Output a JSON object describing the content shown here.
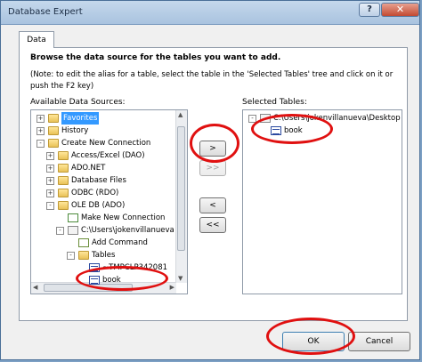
{
  "window": {
    "title": "Database Expert",
    "help_label": "?",
    "close_label": "✕"
  },
  "tab": {
    "label": "Data"
  },
  "instructions": "Browse the data source for the tables you want to add.",
  "note": "(Note: to edit the alias for a table, select the table in the 'Selected Tables' tree and click on it or push the F2 key)",
  "available_label": "Available Data Sources:",
  "selected_label": "Selected Tables:",
  "available_tree": [
    {
      "label": "Favorites",
      "expander": "+",
      "icon": "folder-icon",
      "selected": true
    },
    {
      "label": "History",
      "expander": "+",
      "icon": "folder-icon"
    },
    {
      "label": "Create New Connection",
      "expander": "-",
      "icon": "folder-icon"
    },
    {
      "label": "Access/Excel (DAO)",
      "expander": "+",
      "icon": "folder-icon"
    },
    {
      "label": "ADO.NET",
      "expander": "+",
      "icon": "folder-icon"
    },
    {
      "label": "Database Files",
      "expander": "+",
      "icon": "folder-icon"
    },
    {
      "label": "ODBC (RDO)",
      "expander": "+",
      "icon": "folder-icon"
    },
    {
      "label": "OLE DB (ADO)",
      "expander": "-",
      "icon": "folder-icon"
    },
    {
      "label": "Make New Connection",
      "expander": "",
      "icon": "new-connection-icon"
    },
    {
      "label": "C:\\Users\\jokenvillanueva",
      "expander": "-",
      "icon": "database-icon"
    },
    {
      "label": "Add Command",
      "expander": "",
      "icon": "command-icon"
    },
    {
      "label": "Tables",
      "expander": "-",
      "icon": "folder-icon"
    },
    {
      "label": "~TMPCLP342081",
      "expander": "",
      "icon": "table-icon"
    },
    {
      "label": "book",
      "expander": "",
      "icon": "table-icon"
    }
  ],
  "selected_tree": [
    {
      "label": "C:\\Users\\jokenvillanueva\\Desktop",
      "expander": "-",
      "icon": "database-icon"
    },
    {
      "label": "book",
      "expander": "",
      "icon": "table-icon"
    }
  ],
  "buttons": {
    "add": ">",
    "add_all": ">>",
    "remove": "<",
    "remove_all": "<<",
    "ok": "OK",
    "cancel": "Cancel"
  },
  "colors": {
    "annotation": "#e01010",
    "selection": "#3399ff"
  }
}
